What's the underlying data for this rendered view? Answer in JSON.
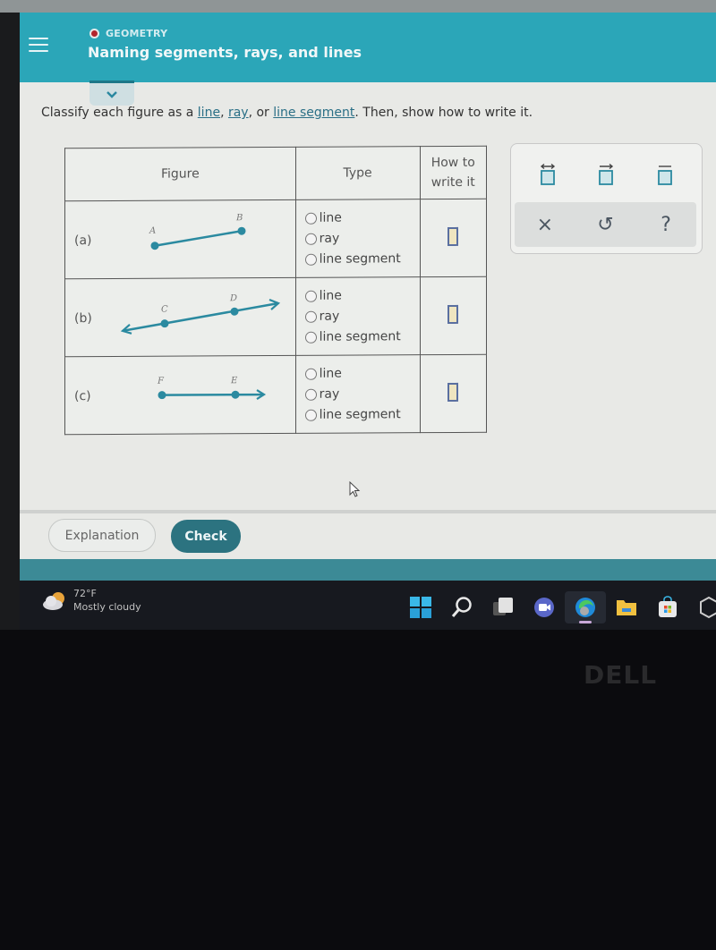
{
  "header": {
    "subject": "GEOMETRY",
    "topic": "Naming segments, rays, and lines",
    "subject_dot_color": "#b2242c",
    "bar_color": "#2ba6b8"
  },
  "prompt": {
    "before": "Classify each figure as a ",
    "link_line": "line",
    "sep1": ", ",
    "link_ray": "ray",
    "sep2": ", or ",
    "link_segment": "line segment",
    "after": ". Then, show how to write it."
  },
  "table": {
    "headers": {
      "figure": "Figure",
      "type": "Type",
      "how_line1": "How to",
      "how_line2": "write it"
    },
    "rows": [
      {
        "label": "(a)",
        "figure": {
          "points": [
            "A",
            "B"
          ],
          "kind": "segment"
        },
        "options": [
          "line",
          "ray",
          "line segment"
        ],
        "selected": null,
        "answer": ""
      },
      {
        "label": "(b)",
        "figure": {
          "points": [
            "C",
            "D"
          ],
          "kind": "line"
        },
        "options": [
          "line",
          "ray",
          "line segment"
        ],
        "selected": null,
        "answer": ""
      },
      {
        "label": "(c)",
        "figure": {
          "points": [
            "F",
            "E"
          ],
          "kind": "ray"
        },
        "options": [
          "line",
          "ray",
          "line segment"
        ],
        "selected": null,
        "answer": ""
      }
    ]
  },
  "palette": {
    "templates": [
      {
        "name": "line-notation",
        "icon": "double-arrow-over-box"
      },
      {
        "name": "ray-notation",
        "icon": "arrow-over-box"
      },
      {
        "name": "segment-notation",
        "icon": "bar-over-box"
      }
    ],
    "actions": [
      {
        "name": "clear",
        "glyph": "×"
      },
      {
        "name": "undo",
        "glyph": "↺"
      },
      {
        "name": "help",
        "glyph": "?"
      }
    ]
  },
  "buttons": {
    "explanation": "Explanation",
    "check": "Check"
  },
  "taskbar": {
    "temperature": "72°F",
    "condition": "Mostly cloudy",
    "apps": [
      "start",
      "search",
      "task-view",
      "teams-meet",
      "edge",
      "file-explorer",
      "microsoft-store",
      "other-app"
    ]
  },
  "bezel": {
    "brand": "DELL"
  }
}
